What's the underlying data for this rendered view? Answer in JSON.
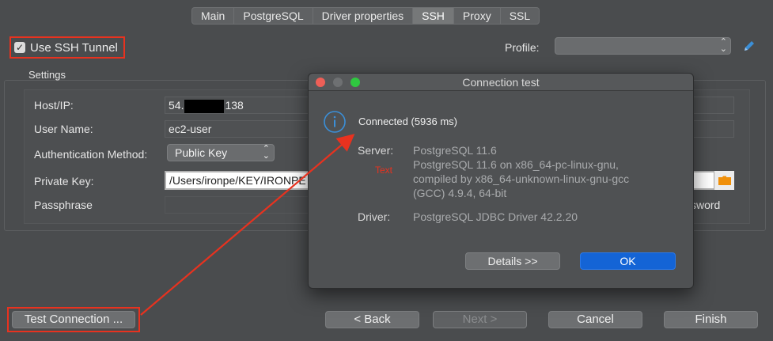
{
  "tabs": [
    {
      "label": "Main"
    },
    {
      "label": "PostgreSQL"
    },
    {
      "label": "Driver properties"
    },
    {
      "label": "SSH"
    },
    {
      "label": "Proxy"
    },
    {
      "label": "SSL"
    }
  ],
  "ssh": {
    "use_tunnel_label": "Use SSH Tunnel",
    "use_tunnel_checked": true
  },
  "profile": {
    "label": "Profile:",
    "value": ""
  },
  "settings": {
    "title": "Settings",
    "host_label": "Host/IP:",
    "host_prefix": "54.",
    "host_suffix": "138",
    "user_label": "User Name:",
    "user_value": "ec2-user",
    "auth_label": "Authentication Method:",
    "auth_value": "Public Key",
    "key_label": "Private Key:",
    "key_value": "/Users/ironpe/KEY/IRONPE",
    "pass_label": "Passphrase",
    "save_password_partial": "ssword"
  },
  "buttons": {
    "test_connection": "Test Connection ...",
    "back": "< Back",
    "next": "Next >",
    "cancel": "Cancel",
    "finish": "Finish"
  },
  "dialog": {
    "title": "Connection test",
    "status": "Connected (5936 ms)",
    "server_label": "Server:",
    "server_line1": "PostgreSQL 11.6",
    "server_line2": "PostgreSQL 11.6 on x86_64-pc-linux-gnu,",
    "server_line3": "compiled by x86_64-unknown-linux-gnu-gcc",
    "server_line4": "(GCC) 4.9.4, 64-bit",
    "annotation_text": "Text",
    "driver_label": "Driver:",
    "driver_value": "PostgreSQL JDBC Driver 42.2.20",
    "details_button": "Details >>",
    "ok_button": "OK"
  },
  "colors": {
    "highlight_red": "#e8321f",
    "ok_blue": "#1464d6",
    "info_blue": "#3b8fd8"
  }
}
